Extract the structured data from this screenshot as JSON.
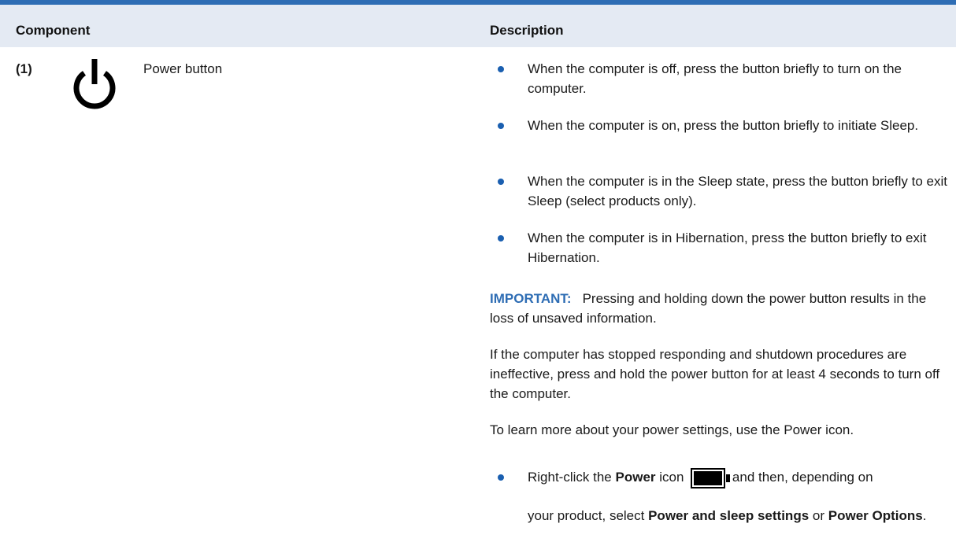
{
  "table": {
    "headers": {
      "component": "Component",
      "description": "Description"
    },
    "row": {
      "number": "(1)",
      "name": "Power button",
      "bullets": [
        "When the computer is off, press the button briefly to turn on the computer.",
        "When the computer is on, press the button briefly to initiate Sleep.",
        "When the computer is in the Sleep state, press the button briefly to exit Sleep (select products only).",
        "When the computer is in Hibernation, press the button briefly to exit Hibernation."
      ],
      "important": {
        "label": "IMPORTANT:",
        "text": "Pressing and holding down the power button results in the loss of unsaved information."
      },
      "stopped_responding": "If the computer has stopped responding and shutdown procedures are ineffective, press and hold the power button for at least 4 seconds to turn off the computer.",
      "learn_more": "To learn more about your power settings, use the Power icon.",
      "final_bullet": {
        "prefix": "Right-click the",
        "power_word": "Power",
        "icon_word": "icon",
        "after_icon": "and then, depending on",
        "line2_prefix": "your product, select",
        "option1": "Power and sleep settings",
        "or_word": "or",
        "option2": "Power Options",
        "end": "."
      }
    }
  },
  "icons": {
    "row_icon": "power-symbol-icon",
    "inline_icon": "battery-icon"
  },
  "colors": {
    "accent": "#2e6db4",
    "header_background": "#e4eaf3",
    "bullet": "#1a5fb0"
  }
}
